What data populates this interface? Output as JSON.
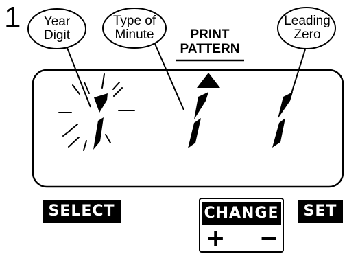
{
  "step_number": "1",
  "labels": {
    "year_digit": [
      "Year",
      "Digit"
    ],
    "type_of_minute": [
      "Type of",
      "Minute"
    ],
    "leading_zero": [
      "Leading",
      "Zero"
    ],
    "print_pattern": [
      "PRINT",
      "PATTERN"
    ]
  },
  "display": {
    "digits": [
      "1",
      "1",
      "1"
    ],
    "blinking_digit": "year-digit"
  },
  "buttons": {
    "select": "SELECT",
    "change": "CHANGE",
    "set": "SET",
    "plus": "+",
    "minus": "−"
  }
}
